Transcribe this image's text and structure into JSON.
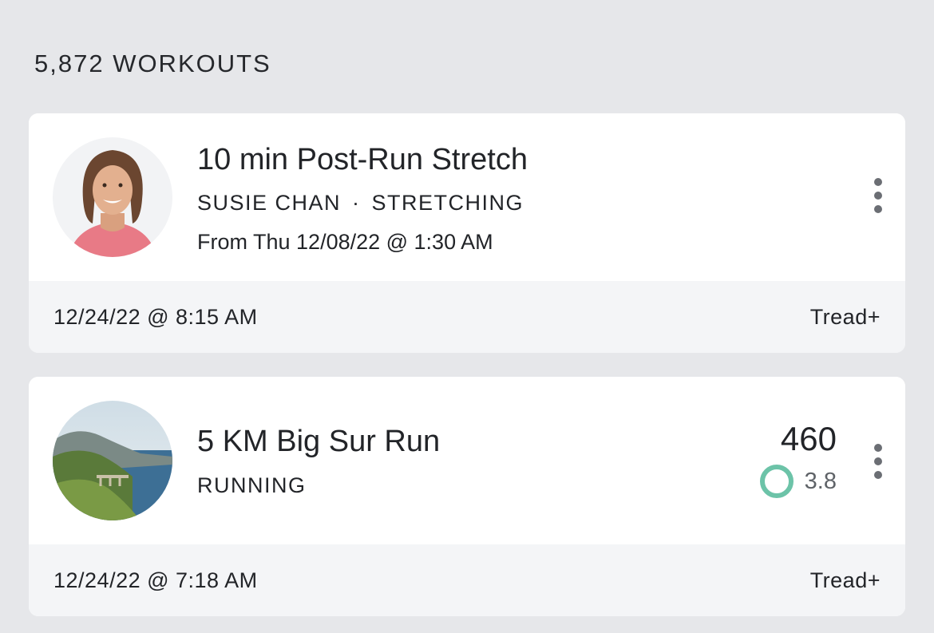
{
  "header": {
    "count_label": "5,872 WORKOUTS"
  },
  "workouts": [
    {
      "title": "10 min Post-Run Stretch",
      "instructor": "SUSIE CHAN",
      "separator": "·",
      "category": "STRETCHING",
      "schedule": "From Thu 12/08/22 @ 1:30 AM",
      "date": "12/24/22 @ 8:15 AM",
      "device": "Tread+",
      "thumbnail": "instructor-portrait"
    },
    {
      "title": "5 KM Big Sur Run",
      "category": "RUNNING",
      "output": "460",
      "strive_score": "3.8",
      "date": "12/24/22 @ 7:18 AM",
      "device": "Tread+",
      "thumbnail": "big-sur-landscape"
    }
  ],
  "colors": {
    "background": "#e6e7ea",
    "card": "#ffffff",
    "footer": "#f4f5f7",
    "strive_ring": "#6cc3a8",
    "kebab": "#6b6e74"
  },
  "icons": {
    "more": "vertical-ellipsis-icon",
    "strive": "ring-icon"
  }
}
